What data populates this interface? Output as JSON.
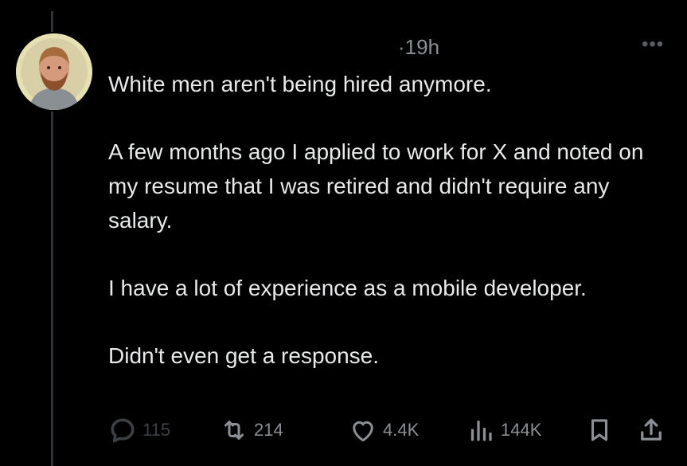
{
  "tweet": {
    "meta_time": "·19h",
    "more_label": "•••",
    "paragraphs": [
      "White men aren't being hired anymore.",
      "A few months ago I applied to work for X and noted on my resume that I was retired and didn't require any salary.",
      "I have a lot of experience as a mobile developer.",
      "Didn't even get a response."
    ]
  },
  "actions": {
    "replies": "115",
    "reposts": "214",
    "likes": "4.4K",
    "views": "144K"
  },
  "icons": {
    "reply": "reply-icon",
    "repost": "repost-icon",
    "like": "heart-icon",
    "views": "views-icon",
    "bookmark": "bookmark-icon",
    "share": "share-icon"
  },
  "colors": {
    "background": "#000000",
    "text": "#e7e9ea",
    "muted": "#8b8f94",
    "avatar_ring": "#e6e1b2"
  }
}
